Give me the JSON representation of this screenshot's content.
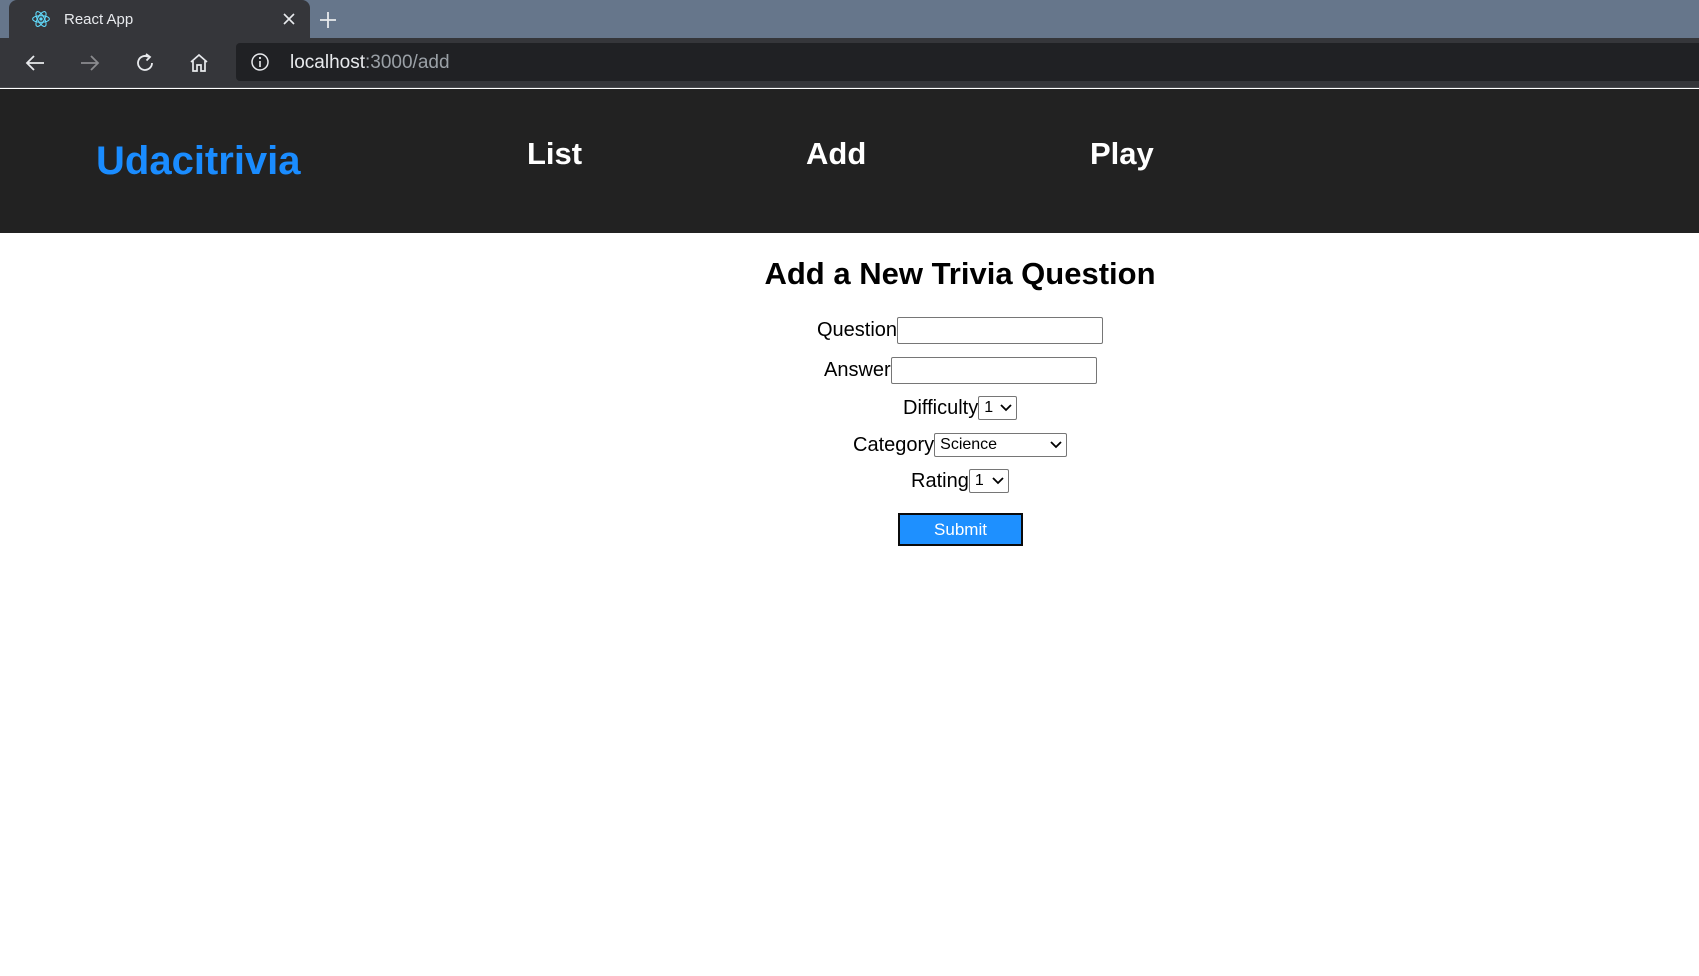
{
  "browser": {
    "tab_title": "React App",
    "url_host": "localhost",
    "url_path": ":3000/add"
  },
  "header": {
    "brand": "Udacitrivia",
    "nav": [
      "List",
      "Add",
      "Play"
    ]
  },
  "form": {
    "title": "Add a New Trivia Question",
    "question_label": "Question",
    "question_value": "",
    "answer_label": "Answer",
    "answer_value": "",
    "difficulty_label": "Difficulty",
    "difficulty_value": "1",
    "category_label": "Category",
    "category_value": "Science",
    "rating_label": "Rating",
    "rating_value": "1",
    "submit_label": "Submit"
  },
  "colors": {
    "brand": "#1a8cff",
    "header_bg": "#222222",
    "submit_bg": "#1e90ff",
    "tabstrip_bg": "#66768b"
  },
  "icons": [
    "react-logo-icon",
    "close-icon",
    "plus-icon",
    "back-arrow-icon",
    "forward-arrow-icon",
    "reload-icon",
    "home-icon",
    "info-icon",
    "chevron-down-icon"
  ]
}
